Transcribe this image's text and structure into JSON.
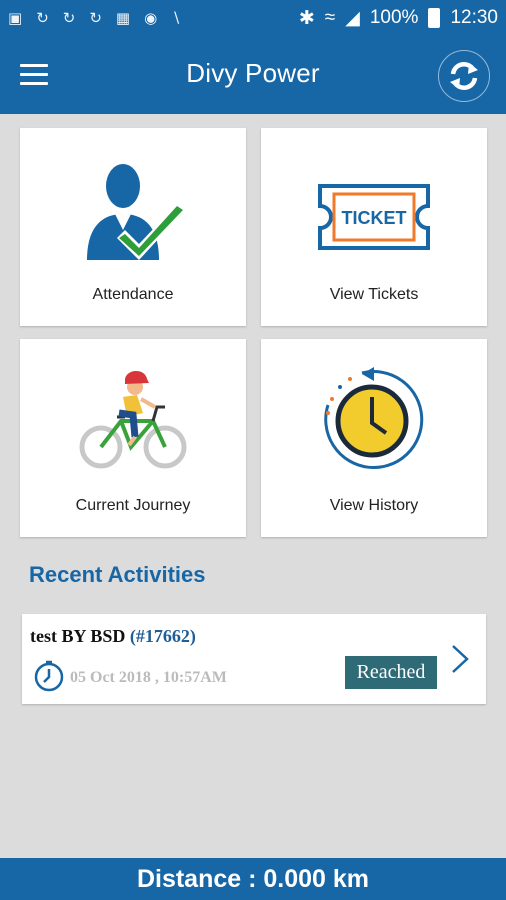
{
  "status_bar": {
    "notification_icons": [
      "chat-icon",
      "sync-icon",
      "sync-icon",
      "sync-icon",
      "image-icon",
      "eye-icon",
      "no-signal-icon"
    ],
    "battery": "100%",
    "time": "12:30"
  },
  "app_bar": {
    "title": "Divy Power",
    "menu_icon": "hamburger-menu-icon",
    "refresh_icon": "refresh-icon"
  },
  "tiles": [
    {
      "label": "Attendance",
      "icon": "attendance-person-check-icon"
    },
    {
      "label": "View Tickets",
      "icon": "ticket-icon",
      "icon_text": "TICKET"
    },
    {
      "label": "Current Journey",
      "icon": "cyclist-icon"
    },
    {
      "label": "View History",
      "icon": "clock-history-icon"
    }
  ],
  "recent": {
    "title": "Recent Activities",
    "items": [
      {
        "name": "test BY BSD",
        "id": "(#17662)",
        "datetime": "05 Oct 2018 , 10:57AM",
        "status": "Reached"
      }
    ]
  },
  "footer": {
    "distance": "Distance : 0.000 km"
  },
  "colors": {
    "primary": "#1766a6",
    "background": "#dcdcdc",
    "badge": "#2f6a77",
    "check_green": "#2e9e3a",
    "ticket_orange": "#f07a2a",
    "clock_yellow": "#f2cc2c"
  }
}
